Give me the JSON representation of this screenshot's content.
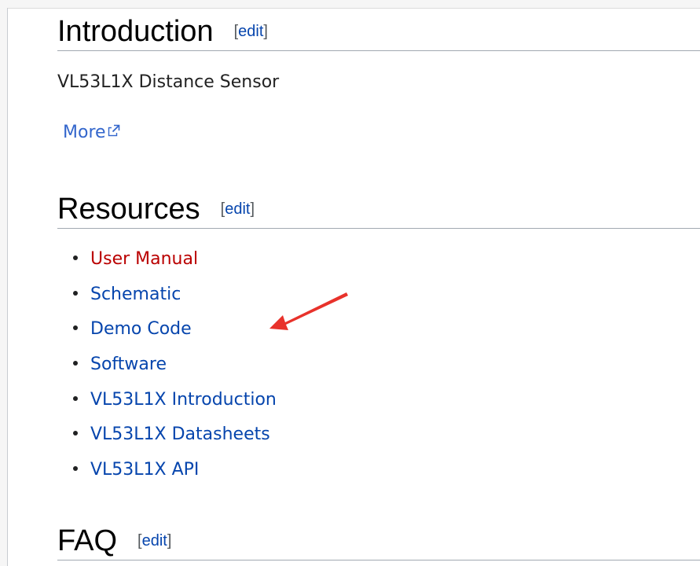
{
  "sections": {
    "introduction": {
      "title": "Introduction",
      "edit_label": "edit",
      "description": "VL53L1X Distance Sensor",
      "more_link": "More"
    },
    "resources": {
      "title": "Resources",
      "edit_label": "edit",
      "items": [
        {
          "label": "User Manual",
          "color": "#ba0000"
        },
        {
          "label": "Schematic",
          "color": "#0645ad"
        },
        {
          "label": "Demo Code",
          "color": "#0645ad"
        },
        {
          "label": "Software",
          "color": "#0645ad"
        },
        {
          "label": "VL53L1X Introduction",
          "color": "#0645ad"
        },
        {
          "label": "VL53L1X Datasheets",
          "color": "#0645ad"
        },
        {
          "label": "VL53L1X API",
          "color": "#0645ad"
        }
      ]
    },
    "faq": {
      "title": "FAQ",
      "edit_label": "edit"
    }
  },
  "annotation": {
    "arrow_color": "#e8322b",
    "points_to": "Demo Code"
  },
  "icons": {
    "external_link": "external-link-icon",
    "annotation_arrow": "red-arrow-icon"
  }
}
